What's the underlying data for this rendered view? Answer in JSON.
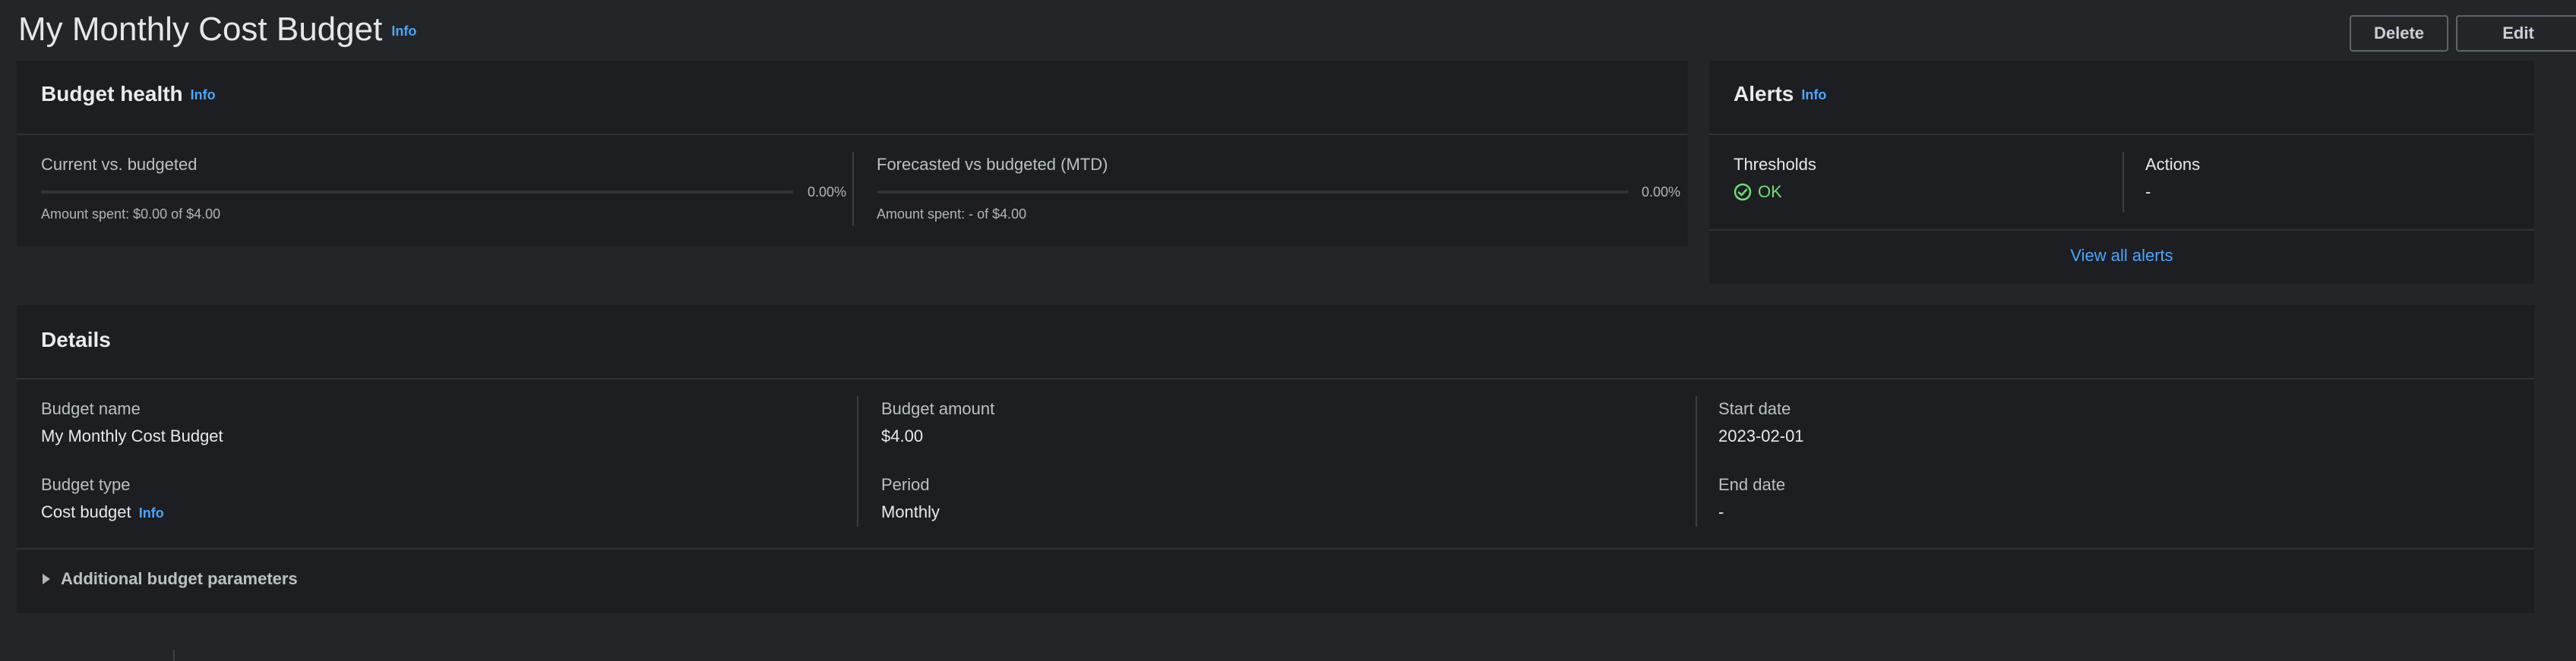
{
  "page": {
    "title": "My Monthly Cost Budget",
    "info": "Info",
    "delete_label": "Delete",
    "edit_label": "Edit"
  },
  "budget_health": {
    "title": "Budget health",
    "info": "Info",
    "current": {
      "label": "Current vs. budgeted",
      "percent_text": "0.00%",
      "progress_fraction": 0,
      "amount_text": "Amount spent: $0.00 of $4.00"
    },
    "forecasted": {
      "label": "Forecasted vs budgeted (MTD)",
      "percent_text": "0.00%",
      "progress_fraction": 0,
      "amount_text": "Amount spent: - of $4.00"
    }
  },
  "alerts": {
    "title": "Alerts",
    "info": "Info",
    "thresholds_label": "Thresholds",
    "thresholds_status": "OK",
    "actions_label": "Actions",
    "actions_value": "-",
    "view_all": "View all alerts"
  },
  "details": {
    "title": "Details",
    "budget_name_label": "Budget name",
    "budget_name": "My Monthly Cost Budget",
    "budget_type_label": "Budget type",
    "budget_type": "Cost budget",
    "budget_type_info": "Info",
    "budget_amount_label": "Budget amount",
    "budget_amount": "$4.00",
    "period_label": "Period",
    "period": "Monthly",
    "start_date_label": "Start date",
    "start_date": "2023-02-01",
    "end_date_label": "End date",
    "end_date": "-",
    "additional_params": "Additional budget parameters"
  },
  "colors": {
    "accent": "#4aa6ff",
    "ok": "#6ee075",
    "background": "#232629",
    "panel": "#1c1e21"
  },
  "icons": {
    "ok": "check-circle-icon",
    "expand": "caret-right-icon"
  }
}
